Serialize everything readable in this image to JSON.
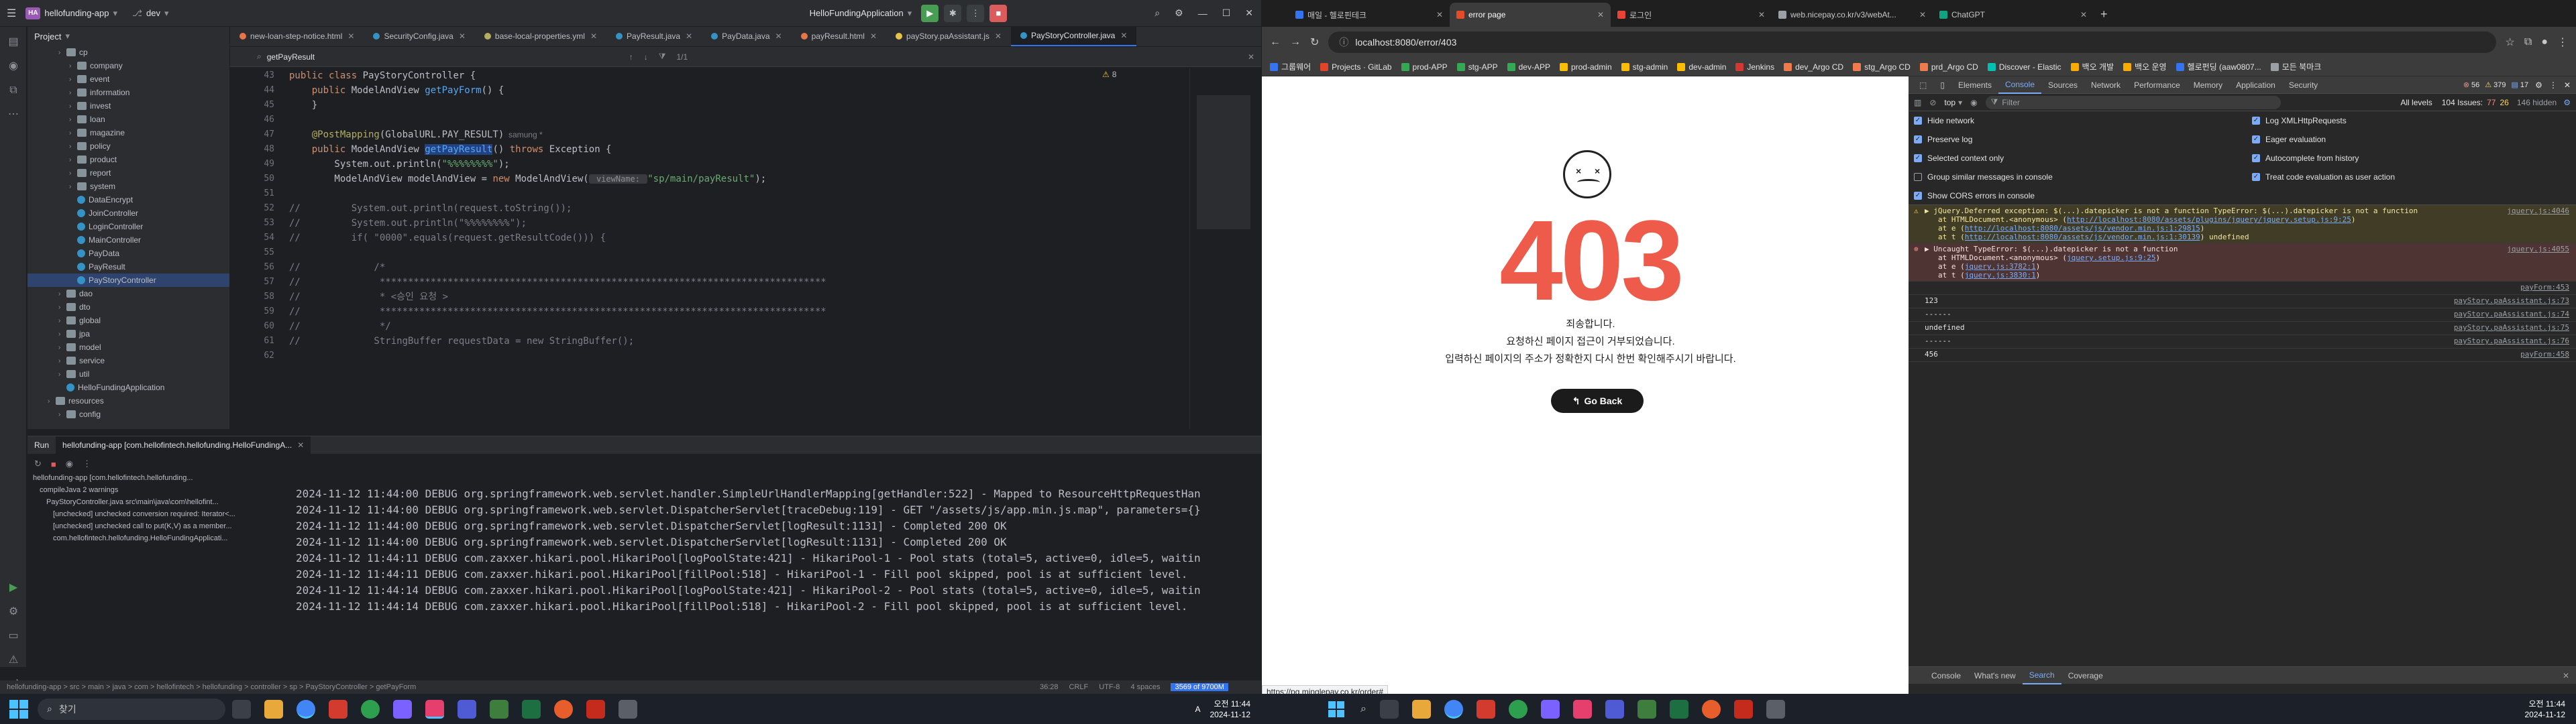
{
  "ide": {
    "project_name": "hellofunding-app",
    "project_badge": "HA",
    "branch": "dev",
    "run_config": "HelloFundingApplication",
    "project_panel_title": "Project",
    "tree": [
      {
        "label": "cp",
        "type": "folder",
        "indent": 2
      },
      {
        "label": "company",
        "type": "folder",
        "indent": 3
      },
      {
        "label": "event",
        "type": "folder",
        "indent": 3
      },
      {
        "label": "information",
        "type": "folder",
        "indent": 3
      },
      {
        "label": "invest",
        "type": "folder",
        "indent": 3
      },
      {
        "label": "loan",
        "type": "folder",
        "indent": 3
      },
      {
        "label": "magazine",
        "type": "folder",
        "indent": 3
      },
      {
        "label": "policy",
        "type": "folder",
        "indent": 3
      },
      {
        "label": "product",
        "type": "folder",
        "indent": 3
      },
      {
        "label": "report",
        "type": "folder",
        "indent": 3
      },
      {
        "label": "system",
        "type": "folder",
        "indent": 3
      },
      {
        "label": "DataEncrypt",
        "type": "cls",
        "indent": 3
      },
      {
        "label": "JoinController",
        "type": "cls",
        "indent": 3
      },
      {
        "label": "LoginController",
        "type": "cls",
        "indent": 3
      },
      {
        "label": "MainController",
        "type": "cls",
        "indent": 3
      },
      {
        "label": "PayData",
        "type": "cls",
        "indent": 3
      },
      {
        "label": "PayResult",
        "type": "cls",
        "indent": 3
      },
      {
        "label": "PayStoryController",
        "type": "cls",
        "indent": 3
      },
      {
        "label": "dao",
        "type": "folder",
        "indent": 2
      },
      {
        "label": "dto",
        "type": "folder",
        "indent": 2
      },
      {
        "label": "global",
        "type": "folder",
        "indent": 2
      },
      {
        "label": "jpa",
        "type": "folder",
        "indent": 2
      },
      {
        "label": "model",
        "type": "folder",
        "indent": 2
      },
      {
        "label": "service",
        "type": "folder",
        "indent": 2
      },
      {
        "label": "util",
        "type": "folder",
        "indent": 2
      },
      {
        "label": "HelloFundingApplication",
        "type": "cls",
        "indent": 2
      },
      {
        "label": "resources",
        "type": "folder",
        "indent": 1
      },
      {
        "label": "config",
        "type": "folder",
        "indent": 2
      }
    ],
    "editor_tabs": [
      {
        "label": "new-loan-step-notice.html",
        "color": "#e8754a"
      },
      {
        "label": "SecurityConfig.java",
        "color": "#3592c4"
      },
      {
        "label": "base-local-properties.yml",
        "color": "#b3ae60"
      },
      {
        "label": "PayResult.java",
        "color": "#3592c4"
      },
      {
        "label": "PayData.java",
        "color": "#3592c4"
      },
      {
        "label": "payResult.html",
        "color": "#e8754a"
      },
      {
        "label": "payStory.paAssistant.js",
        "color": "#e8c34a"
      },
      {
        "label": "PayStoryController.java",
        "color": "#3592c4"
      }
    ],
    "find_query": "getPayResult",
    "find_count": "1/1",
    "line_numbers": [
      "43",
      "44",
      "45",
      "46",
      "47",
      "48",
      "49",
      "50",
      "51",
      "52",
      "53",
      "54",
      "55",
      "56",
      "57",
      "58",
      "59",
      "60",
      "61",
      "62"
    ],
    "code": {
      "l43a": "public class ",
      "l43b": "PayStoryController",
      "l43c": " {",
      "l44a": "    public ",
      "l44b": "ModelAndView ",
      "l44c": "getPayForm",
      "l44d": "() {",
      "l45": "    }",
      "l47a": "    @PostMapping",
      "l47b": "(GlobalURL.PAY_RESULT)",
      "l47c": "  samung *",
      "l48a": "    public ",
      "l48b": "ModelAndView ",
      "l48c": "getPayResult",
      "l48d": "() ",
      "l48e": "throws ",
      "l48f": "Exception {",
      "l49a": "        System.out.println(",
      "l49b": "\"%%%%%%%%\"",
      "l49c": ");",
      "l50a": "        ModelAndView modelAndView = ",
      "l50b": "new ",
      "l50c": "ModelAndView(",
      "l50d": " viewName: ",
      "l50e": "\"sp/main/payResult\"",
      "l50f": ");",
      "l52": "//         System.out.println(request.toString());",
      "l53": "//         System.out.println(\"%%%%%%%%\");",
      "l54": "//         if( \"0000\".equals(request.getResultCode())) {",
      "l56": "//             /*",
      "l57": "//              *******************************************************************************",
      "l58": "//              * <승인 요청 >",
      "l59": "//              *******************************************************************************",
      "l60": "//              */",
      "l61": "//             StringBuffer requestData = new StringBuffer();"
    },
    "warnings_count": "8",
    "run_tab_label": "Run",
    "run_config_tab": "hellofunding-app [com.hellofintech.hellofunding.HelloFundingA...",
    "run_tree": [
      "hellofunding-app [com.hellofintech.hellofunding...",
      "compileJava  2 warnings",
      "PayStoryController.java src\\main\\java\\com\\hellofint...",
      "[unchecked] unchecked conversion required: Iterator<...",
      "[unchecked] unchecked call to put(K,V) as a member...",
      "com.hellofintech.hellofunding.HelloFundingApplicati..."
    ],
    "console_lines": [
      "2024-11-12 11:44:00 DEBUG org.springframework.web.servlet.handler.SimpleUrlHandlerMapping[getHandler:522] - Mapped to ResourceHttpRequestHan",
      "2024-11-12 11:44:00 DEBUG org.springframework.web.servlet.DispatcherServlet[traceDebug:119] - GET \"/assets/js/app.min.js.map\", parameters={}",
      "2024-11-12 11:44:00 DEBUG org.springframework.web.servlet.DispatcherServlet[logResult:1131] - Completed 200 OK",
      "2024-11-12 11:44:00 DEBUG org.springframework.web.servlet.DispatcherServlet[logResult:1131] - Completed 200 OK",
      "2024-11-12 11:44:11 DEBUG com.zaxxer.hikari.pool.HikariPool[logPoolState:421] - HikariPool-1 - Pool stats (total=5, active=0, idle=5, waitin",
      "2024-11-12 11:44:11 DEBUG com.zaxxer.hikari.pool.HikariPool[fillPool:518] - HikariPool-1 - Fill pool skipped, pool is at sufficient level.",
      "2024-11-12 11:44:14 DEBUG com.zaxxer.hikari.pool.HikariPool[logPoolState:421] - HikariPool-2 - Pool stats (total=5, active=0, idle=5, waitin",
      "2024-11-12 11:44:14 DEBUG com.zaxxer.hikari.pool.HikariPool[fillPool:518] - HikariPool-2 - Fill pool skipped, pool is at sufficient level."
    ],
    "status_breadcrumb": "hellofunding-app  >  src  >  main  >  java  >  com  >  hellofintech  >  hellofunding  >  controller  >  sp  >  PayStoryController  >  getPayForm",
    "status_position": "36:28",
    "status_crlf": "CRLF",
    "status_encoding": "UTF-8",
    "status_indent": "4 spaces",
    "status_memory": "3569 of 9700M"
  },
  "browser": {
    "tabs": [
      {
        "label": "매일 - 헬로핀테크",
        "color": "#3574f0"
      },
      {
        "label": "error page",
        "color": "#e34c26"
      },
      {
        "label": "로그인",
        "color": "#ea4335"
      },
      {
        "label": "web.nicepay.co.kr/v3/webAt...",
        "color": "#9aa0a6"
      },
      {
        "label": "ChatGPT",
        "color": "#10a37f"
      }
    ],
    "url": "localhost:8080/error/403",
    "bookmarks": [
      "그룹웨어",
      "Projects · GitLab",
      "prod-APP",
      "stg-APP",
      "dev-APP",
      "prod-admin",
      "stg-admin",
      "dev-admin",
      "Jenkins",
      "dev_Argo CD",
      "stg_Argo CD",
      "prd_Argo CD",
      "Discover - Elastic",
      "백오 개발",
      "백오 운영",
      "헬로펀딩 (aaw0807...",
      "모든 북마크"
    ],
    "error_code": "403",
    "error_line1": "죄송합니다.",
    "error_line2": "요청하신 페이지 접근이 거부되었습니다.",
    "error_line3": "입력하신 페이지의 주소가 정확한지 다시 한번 확인해주시기 바랍니다.",
    "go_back": "Go Back",
    "status_url": "https://pg.minglepay.co.kr/order#"
  },
  "devtools": {
    "tabs": [
      "Elements",
      "Console",
      "Sources",
      "Network",
      "Performance",
      "Memory",
      "Application",
      "Security"
    ],
    "counts": {
      "errors": "56",
      "warnings": "379",
      "info": "17"
    },
    "context": "top",
    "filter_placeholder": "Filter",
    "levels": "All levels",
    "issues": "104 Issues:",
    "issue_counts": [
      "77",
      "26"
    ],
    "hidden": "146 hidden",
    "settings_left": [
      "Hide network",
      "Preserve log",
      "Selected context only",
      "Group similar messages in console",
      "Show CORS errors in console"
    ],
    "settings_right": [
      "Log XMLHttpRequests",
      "Eager evaluation",
      "Autocomplete from history",
      "Treat code evaluation as user action"
    ],
    "msg1_title": "▶ jQuery.Deferred exception: $(...).datepicker is not a function TypeError: $(...).datepicker is not a function",
    "msg1_l2": "at HTMLDocument.<anonymous> (",
    "msg1_l2link": "http://localhost:8080/assets/plugins/jquery/jquery.setup.js:9:25",
    "msg1_l3": "at e (",
    "msg1_l3link": "http://localhost:8080/assets/js/vendor.min.js:1:29815",
    "msg1_l4": "at t (",
    "msg1_l4link": "http://localhost:8080/assets/js/vendor.min.js:1:30139",
    "msg1_l4tail": ") undefined",
    "msg1_src": "jquery.js:4046",
    "msg2_title": "▶ Uncaught TypeError: $(...).datepicker is not a function",
    "msg2_l2": "at HTMLDocument.<anonymous> (",
    "msg2_l2link": "jquery.setup.js:9:25",
    "msg2_l3": "at e (",
    "msg2_l3link": "jquery.js:3782:1",
    "msg2_l4": "at t (",
    "msg2_l4link": "jquery.js:3830:1",
    "msg2_src": "jquery.js:4055",
    "plain_msgs": [
      {
        "text": "",
        "src": "payForm:453"
      },
      {
        "text": "123",
        "src": "payStory.paAssistant.js:73"
      },
      {
        "text": "------",
        "src": "payStory.paAssistant.js:74"
      },
      {
        "text": "undefined",
        "src": "payStory.paAssistant.js:75"
      },
      {
        "text": "------",
        "src": "payStory.paAssistant.js:76"
      },
      {
        "text": "456",
        "src": "payForm:458"
      }
    ],
    "drawer_tabs": [
      "Console",
      "What's new",
      "Search",
      "Coverage"
    ]
  },
  "taskbar_left": {
    "search_placeholder": "찾기",
    "time": "오전 11:44",
    "date": "2024-11-12",
    "ime": "A"
  },
  "taskbar_right": {
    "time": "오전 11:44",
    "date": "2024-11-12"
  }
}
